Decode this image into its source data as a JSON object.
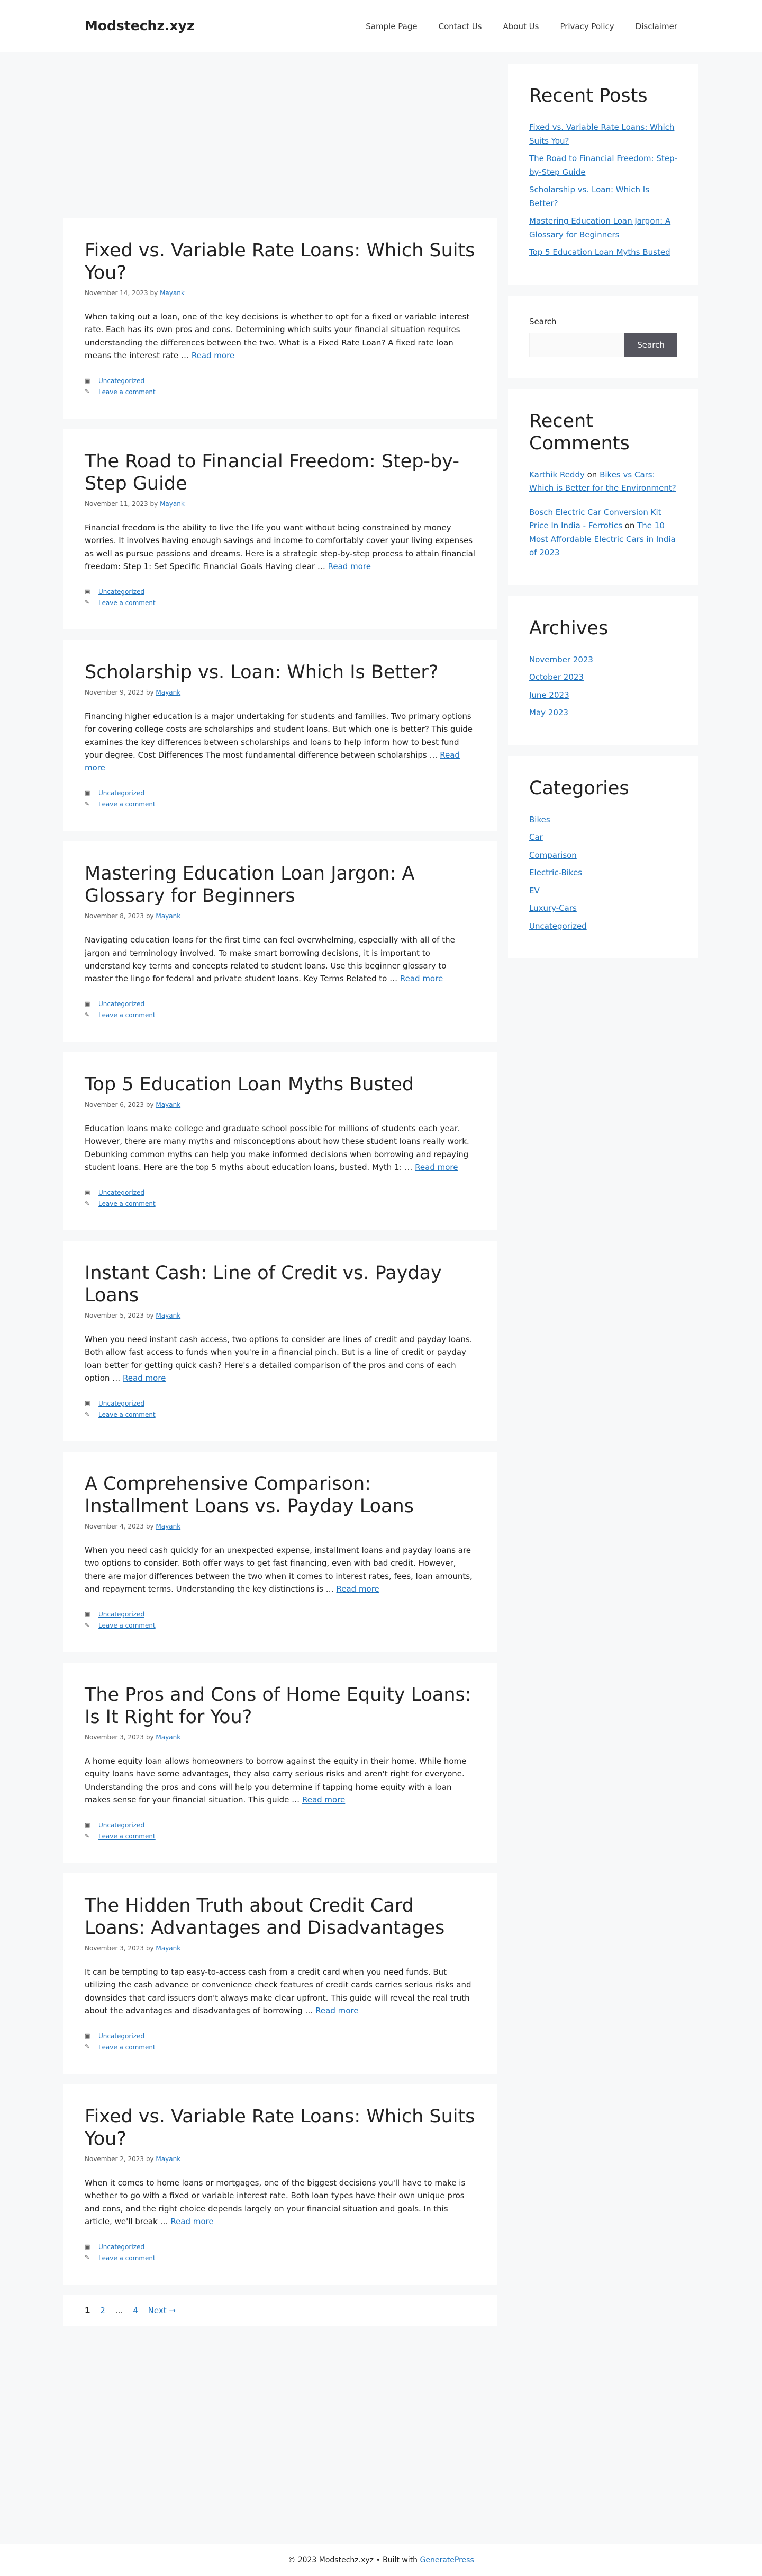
{
  "site": {
    "title": "Modstechz.xyz"
  },
  "nav": [
    {
      "label": "Sample Page"
    },
    {
      "label": "Contact Us"
    },
    {
      "label": "About Us"
    },
    {
      "label": "Privacy Policy"
    },
    {
      "label": "Disclaimer"
    }
  ],
  "posts": [
    {
      "title": "Fixed vs. Variable Rate Loans: Which Suits You?",
      "date": "November 14, 2023",
      "by": "by",
      "author": "Mayank",
      "summary": "When taking out a loan, one of the key decisions is whether to opt for a fixed or variable interest rate. Each has its own pros and cons. Determining which suits your financial situation requires understanding the differences between the two. What is a Fixed Rate Loan? A fixed rate loan means the interest rate …",
      "read_more": "Read more",
      "category": "Uncategorized",
      "comment": "Leave a comment"
    },
    {
      "title": "The Road to Financial Freedom: Step-by-Step Guide",
      "date": "November 11, 2023",
      "by": "by",
      "author": "Mayank",
      "summary": "Financial freedom is the ability to live the life you want without being constrained by money worries. It involves having enough savings and income to comfortably cover your living expenses as well as pursue passions and dreams. Here is a strategic step-by-step process to attain financial freedom: Step 1: Set Specific Financial Goals Having clear …",
      "read_more": "Read more",
      "category": "Uncategorized",
      "comment": "Leave a comment"
    },
    {
      "title": "Scholarship vs. Loan: Which Is Better?",
      "date": "November 9, 2023",
      "by": "by",
      "author": "Mayank",
      "summary": "Financing higher education is a major undertaking for students and families. Two primary options for covering college costs are scholarships and student loans. But which one is better? This guide examines the key differences between scholarships and loans to help inform how to best fund your degree. Cost Differences The most fundamental difference between scholarships …",
      "read_more": "Read more",
      "category": "Uncategorized",
      "comment": "Leave a comment"
    },
    {
      "title": "Mastering Education Loan Jargon: A Glossary for Beginners",
      "date": "November 8, 2023",
      "by": "by",
      "author": "Mayank",
      "summary": "Navigating education loans for the first time can feel overwhelming, especially with all of the jargon and terminology involved. To make smart borrowing decisions, it is important to understand key terms and concepts related to student loans. Use this beginner glossary to master the lingo for federal and private student loans. Key Terms Related to …",
      "read_more": "Read more",
      "category": "Uncategorized",
      "comment": "Leave a comment"
    },
    {
      "title": "Top 5 Education Loan Myths Busted",
      "date": "November 6, 2023",
      "by": "by",
      "author": "Mayank",
      "summary": "Education loans make college and graduate school possible for millions of students each year. However, there are many myths and misconceptions about how these student loans really work. Debunking common myths can help you make informed decisions when borrowing and repaying student loans. Here are the top 5 myths about education loans, busted. Myth 1: …",
      "read_more": "Read more",
      "category": "Uncategorized",
      "comment": "Leave a comment"
    },
    {
      "title": "Instant Cash: Line of Credit vs. Payday Loans",
      "date": "November 5, 2023",
      "by": "by",
      "author": "Mayank",
      "summary": "When you need instant cash access, two options to consider are lines of credit and payday loans. Both allow fast access to funds when you're in a financial pinch. But is a line of credit or payday loan better for getting quick cash? Here's a detailed comparison of the pros and cons of each option …",
      "read_more": "Read more",
      "category": "Uncategorized",
      "comment": "Leave a comment"
    },
    {
      "title": "A Comprehensive Comparison: Installment Loans vs. Payday Loans",
      "date": "November 4, 2023",
      "by": "by",
      "author": "Mayank",
      "summary": "When you need cash quickly for an unexpected expense, installment loans and payday loans are two options to consider. Both offer ways to get fast financing, even with bad credit. However, there are major differences between the two when it comes to interest rates, fees, loan amounts, and repayment terms. Understanding the key distinctions is …",
      "read_more": "Read more",
      "category": "Uncategorized",
      "comment": "Leave a comment"
    },
    {
      "title": "The Pros and Cons of Home Equity Loans: Is It Right for You?",
      "date": "November 3, 2023",
      "by": "by",
      "author": "Mayank",
      "summary": "A home equity loan allows homeowners to borrow against the equity in their home. While home equity loans have some advantages, they also carry serious risks and aren't right for everyone. Understanding the pros and cons will help you determine if tapping home equity with a loan makes sense for your financial situation. This guide …",
      "read_more": "Read more",
      "category": "Uncategorized",
      "comment": "Leave a comment"
    },
    {
      "title": "The Hidden Truth about Credit Card Loans: Advantages and Disadvantages",
      "date": "November 3, 2023",
      "by": "by",
      "author": "Mayank",
      "summary": "It can be tempting to tap easy-to-access cash from a credit card when you need funds. But utilizing the cash advance or convenience check features of credit cards carries serious risks and downsides that card issuers don't always make clear upfront. This guide will reveal the real truth about the advantages and disadvantages of borrowing …",
      "read_more": "Read more",
      "category": "Uncategorized",
      "comment": "Leave a comment"
    },
    {
      "title": "Fixed vs. Variable Rate Loans: Which Suits You?",
      "date": "November 2, 2023",
      "by": "by",
      "author": "Mayank",
      "summary": "When it comes to home loans or mortgages, one of the biggest decisions you'll have to make is whether to go with a fixed or variable interest rate. Both loan types have their own unique pros and cons, and the right choice depends largely on your financial situation and goals. In this article, we'll break …",
      "read_more": "Read more",
      "category": "Uncategorized",
      "comment": "Leave a comment"
    }
  ],
  "pagination": {
    "current": "1",
    "page2": "2",
    "dots": "…",
    "last": "4",
    "next": "Next →"
  },
  "sidebar": {
    "recent_posts": {
      "title": "Recent Posts",
      "items": [
        "Fixed vs. Variable Rate Loans: Which Suits You?",
        "The Road to Financial Freedom: Step-by-Step Guide",
        "Scholarship vs. Loan: Which Is Better?",
        "Mastering Education Loan Jargon: A Glossary for Beginners",
        "Top 5 Education Loan Myths Busted"
      ]
    },
    "search": {
      "label": "Search",
      "button": "Search"
    },
    "recent_comments": {
      "title": "Recent Comments",
      "items": [
        {
          "author": "Karthik Reddy",
          "on": "on",
          "post": "Bikes vs Cars: Which is Better for the Environment?"
        },
        {
          "author": "Bosch Electric Car Conversion Kit Price In India - Ferrotics",
          "on": "on",
          "post": "The 10 Most Affordable Electric Cars in India of 2023"
        }
      ]
    },
    "archives": {
      "title": "Archives",
      "items": [
        "November 2023",
        "October 2023",
        "June 2023",
        "May 2023"
      ]
    },
    "categories": {
      "title": "Categories",
      "items": [
        "Bikes",
        "Car",
        "Comparison",
        "Electric-Bikes",
        "EV",
        "Luxury-Cars",
        "Uncategorized"
      ]
    }
  },
  "footer": {
    "copyright": "© 2023 Modstechz.xyz • Built with",
    "link": "GeneratePress"
  }
}
